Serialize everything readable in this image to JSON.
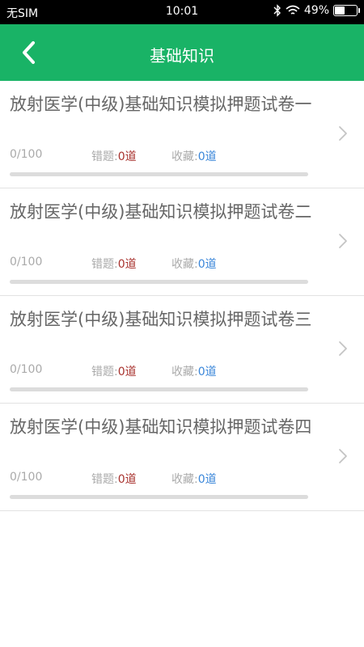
{
  "status": {
    "carrier": "无SIM",
    "time": "10:01",
    "battery": "49%",
    "battery_level": 0.49,
    "icons": [
      "bluetooth-icon",
      "wifi-icon",
      "battery-icon"
    ]
  },
  "nav": {
    "title": "基础知识",
    "back_icon": "chevron-left-icon"
  },
  "colors": {
    "primary": "#19b366",
    "wrong_count": "#a8322e",
    "favorite_count": "#3a86d9"
  },
  "items": [
    {
      "title": "放射医学(中级)基础知识模拟押题试卷一",
      "progress": "0/100",
      "progress_value": 0,
      "wrong_label": "错题:",
      "wrong_count": "0道",
      "fav_label": "收藏:",
      "fav_count": "0道"
    },
    {
      "title": "放射医学(中级)基础知识模拟押题试卷二",
      "progress": "0/100",
      "progress_value": 0,
      "wrong_label": "错题:",
      "wrong_count": "0道",
      "fav_label": "收藏:",
      "fav_count": "0道"
    },
    {
      "title": "放射医学(中级)基础知识模拟押题试卷三",
      "progress": "0/100",
      "progress_value": 0,
      "wrong_label": "错题:",
      "wrong_count": "0道",
      "fav_label": "收藏:",
      "fav_count": "0道"
    },
    {
      "title": "放射医学(中级)基础知识模拟押题试卷四",
      "progress": "0/100",
      "progress_value": 0,
      "wrong_label": "错题:",
      "wrong_count": "0道",
      "fav_label": "收藏:",
      "fav_count": "0道"
    }
  ]
}
